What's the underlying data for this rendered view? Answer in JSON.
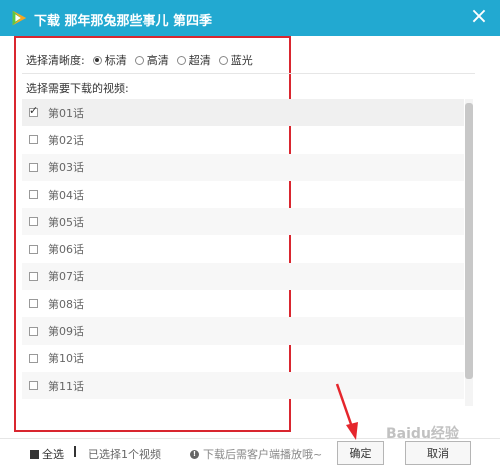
{
  "window": {
    "title": "下载   那年那兔那些事儿 第四季",
    "close_label": "×"
  },
  "quality": {
    "label": "选择清晰度:",
    "options": [
      {
        "label": "标清",
        "checked": true
      },
      {
        "label": "高清",
        "checked": false
      },
      {
        "label": "超清",
        "checked": false
      },
      {
        "label": "蓝光",
        "checked": false
      }
    ]
  },
  "list": {
    "label": "选择需要下载的视频:",
    "items": [
      {
        "label": "第01话",
        "checked": true
      },
      {
        "label": "第02话",
        "checked": false
      },
      {
        "label": "第03话",
        "checked": false
      },
      {
        "label": "第04话",
        "checked": false
      },
      {
        "label": "第05话",
        "checked": false
      },
      {
        "label": "第06话",
        "checked": false
      },
      {
        "label": "第07话",
        "checked": false
      },
      {
        "label": "第08话",
        "checked": false
      },
      {
        "label": "第09话",
        "checked": false
      },
      {
        "label": "第10话",
        "checked": false
      },
      {
        "label": "第11话",
        "checked": false
      }
    ]
  },
  "footer": {
    "select_all_label": "全选",
    "selected_count": "已选择1个视频",
    "notice": "下载后需客户端播放哦~",
    "ok_label": "确定",
    "cancel_label": "取消"
  },
  "watermark": "Baidu经验",
  "colors": {
    "titlebar": "#22a9d1",
    "highlight_frame": "#d9262f",
    "arrow": "#e5262c"
  },
  "icons": {
    "logo": "tencent-video-logo-icon",
    "close": "close-icon",
    "info": "info-icon"
  }
}
